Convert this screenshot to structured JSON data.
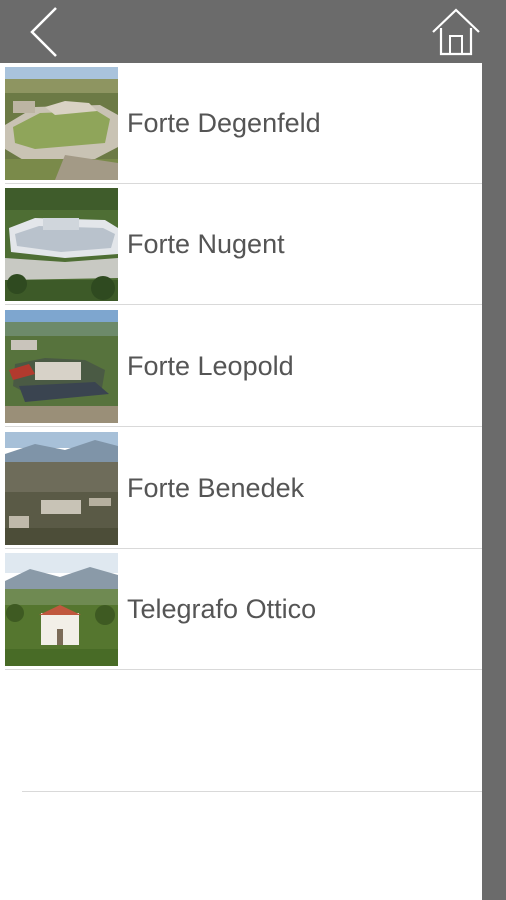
{
  "nav": {
    "back_icon": "chevron-left-icon",
    "home_icon": "home-icon"
  },
  "items": [
    {
      "label": "Forte Degenfeld",
      "thumb": "fort-aerial-photo"
    },
    {
      "label": "Forte Nugent",
      "thumb": "fort-aerial-photo"
    },
    {
      "label": "Forte Leopold",
      "thumb": "fort-aerial-photo"
    },
    {
      "label": "Forte Benedek",
      "thumb": "fort-aerial-photo"
    },
    {
      "label": "Telegrafo Ottico",
      "thumb": "tower-aerial-photo"
    }
  ],
  "colors": {
    "bar": "#6b6b6b",
    "text": "#555555",
    "separator": "#d9d9d9"
  }
}
